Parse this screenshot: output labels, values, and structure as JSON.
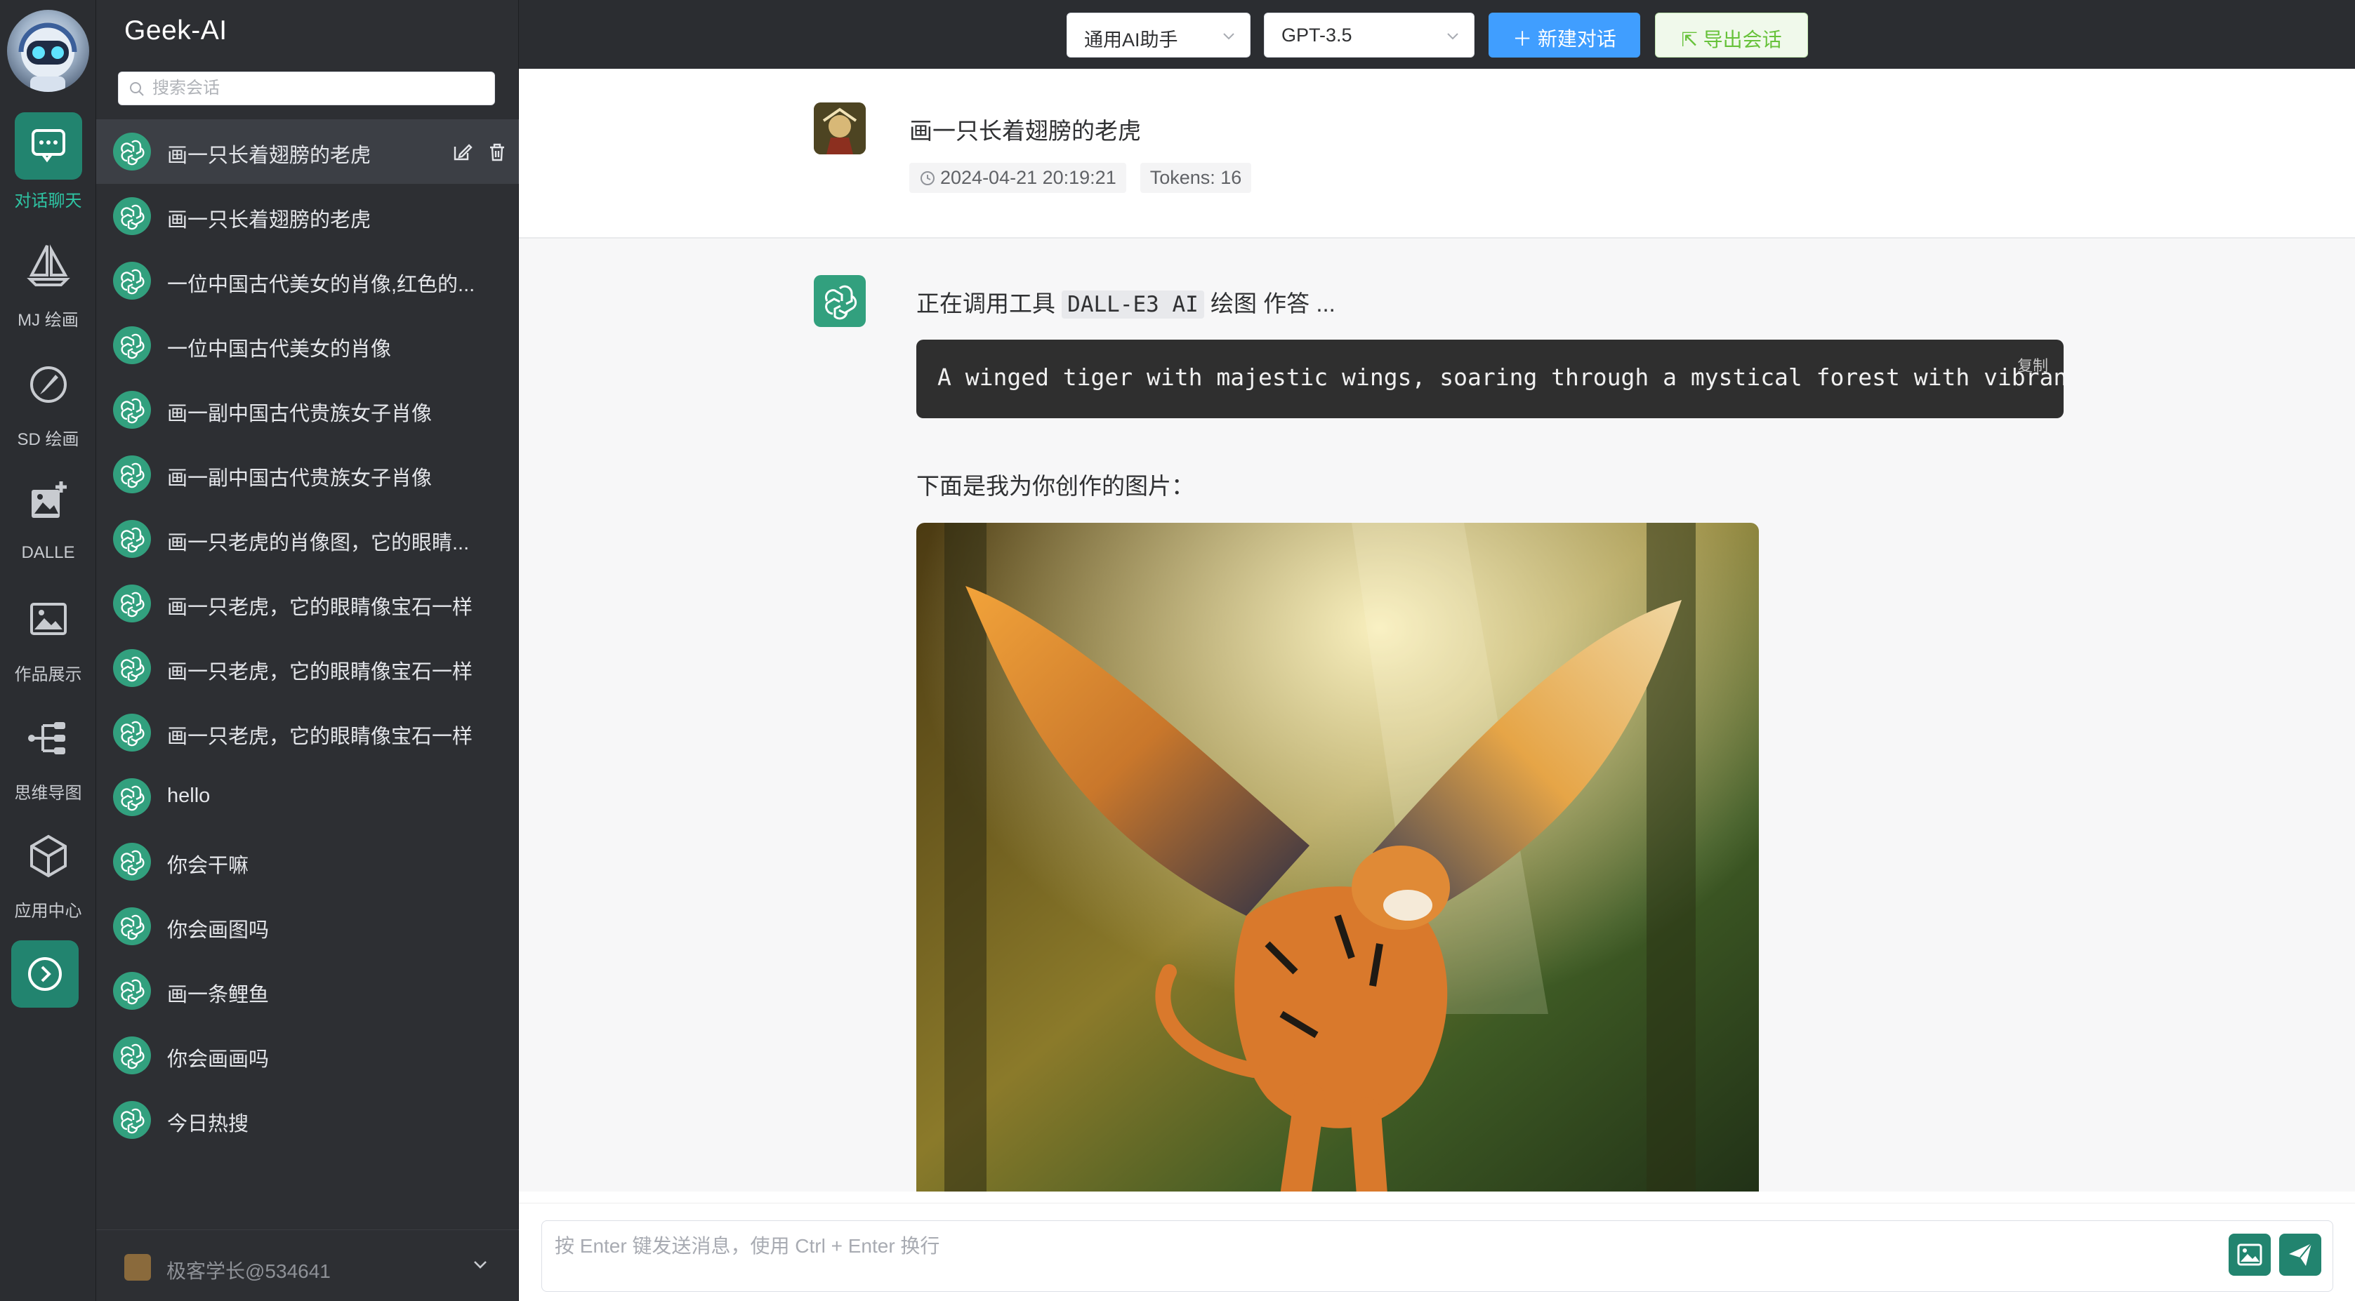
{
  "app": {
    "brand": "Geek-AI"
  },
  "rail": {
    "items": [
      {
        "label": "对话聊天",
        "icon": "chat-icon",
        "active": true
      },
      {
        "label": "MJ 绘画",
        "icon": "sailboat-icon"
      },
      {
        "label": "SD 绘画",
        "icon": "brush-icon"
      },
      {
        "label": "DALLE",
        "icon": "image-add-icon"
      },
      {
        "label": "作品展示",
        "icon": "picture-icon"
      },
      {
        "label": "思维导图",
        "icon": "mindmap-icon"
      },
      {
        "label": "应用中心",
        "icon": "cube-icon"
      }
    ],
    "toggle_icon": "chevron-right-circle-icon"
  },
  "sidebar": {
    "search_placeholder": "搜索会话",
    "chats": [
      "画一只长着翅膀的老虎",
      "画一只长着翅膀的老虎",
      "一位中国古代美女的肖像,红色的...",
      "一位中国古代美女的肖像",
      "画一副中国古代贵族女子肖像",
      "画一副中国古代贵族女子肖像",
      "画一只老虎的肖像图，它的眼睛...",
      "画一只老虎，它的眼睛像宝石一样",
      "画一只老虎，它的眼睛像宝石一样",
      "画一只老虎，它的眼睛像宝石一样",
      "hello",
      "你会干嘛",
      "你会画图吗",
      "画一条鲤鱼",
      "你会画画吗",
      "今日热搜"
    ],
    "user_name": "极客学长@534641"
  },
  "topbar": {
    "role_select": "通用AI助手",
    "model_select": "GPT-3.5",
    "new_chat_label": "新建对话",
    "export_label": "导出会话"
  },
  "question": {
    "text": "画一只长着翅膀的老虎",
    "time": "2024-04-21 20:19:21",
    "tokens": "Tokens: 16"
  },
  "answer": {
    "line1_prefix": "正在调用工具",
    "tool_code": "DALL-E3 AI",
    "line1_mid": "绘图",
    "line1_suffix": "作答 ...",
    "code": "A winged tiger with majestic wings, soaring through a mystical forest with vibrant",
    "copy_label": "复制",
    "line2": "下面是我为你创作的图片："
  },
  "input": {
    "placeholder": "按 Enter 键发送消息，使用 Ctrl + Enter 换行"
  },
  "colors": {
    "accent": "#22846f",
    "rail_bg": "#2b2d31",
    "sidebar_bg": "#2d2f33",
    "primary_button": "#409eff"
  }
}
